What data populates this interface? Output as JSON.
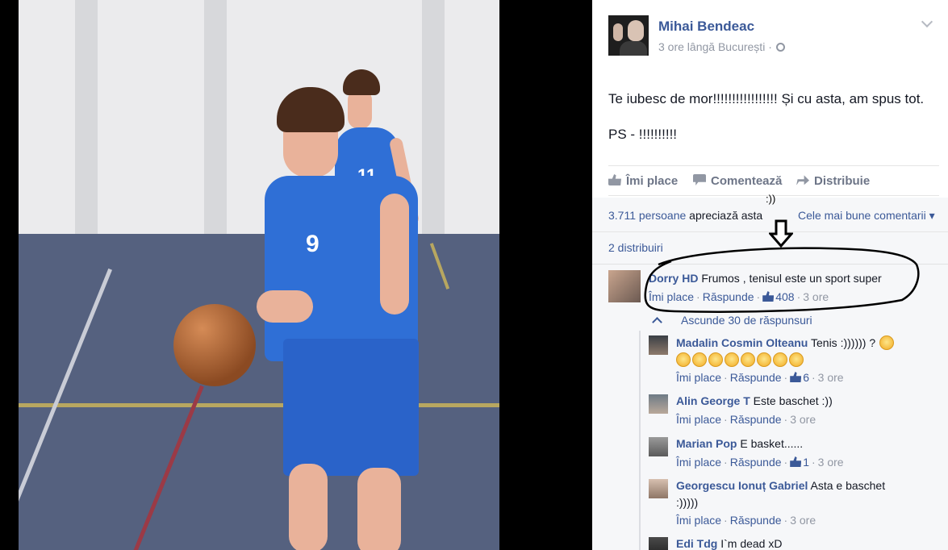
{
  "post": {
    "author": "Mihai Bendeac",
    "meta": "3 ore lângă București ·",
    "text": "Te iubesc de mor!!!!!!!!!!!!!!!!! Și cu asta, am spus tot.",
    "ps": "PS - !!!!!!!!!!"
  },
  "actions": {
    "like": "Îmi place",
    "comment": "Comentează",
    "share": "Distribuie"
  },
  "annotation": {
    "smile": ":))"
  },
  "stats": {
    "likes_number": "3.711 persoane",
    "likes_rest": " apreciază asta",
    "sort": "Cele mai bune comentarii",
    "shares": "2 distribuiri"
  },
  "top_comment": {
    "name": "Dorry HD",
    "text": " Frumos , tenisul este un sport super",
    "like": "Îmi place",
    "reply": "Răspunde",
    "likes": "408",
    "time": "3 ore"
  },
  "collapse": "Ascunde 30 de răspunsuri",
  "replies": [
    {
      "name": "Madalin Cosmin Olteanu",
      "text": " Tenis :)))))) ?",
      "like": "Îmi place",
      "reply": "Răspunde",
      "likes": "6",
      "time": "3 ore"
    },
    {
      "name": "Alin George T",
      "text": " Este baschet :))",
      "like": "Îmi place",
      "reply": "Răspunde",
      "time": "3 ore"
    },
    {
      "name": "Marian Pop",
      "text": " E basket......",
      "like": "Îmi place",
      "reply": "Răspunde",
      "likes": "1",
      "time": "3 ore"
    },
    {
      "name": "Georgescu Ionuț Gabriel",
      "text": " Asta e baschet",
      "text2": ":)))))",
      "like": "Îmi place",
      "reply": "Răspunde",
      "time": "3 ore"
    },
    {
      "name": "Edi Tdg",
      "text": " I`m dead xD"
    }
  ],
  "photo_jersey": {
    "front_number": "9",
    "back_number": "11"
  },
  "colors": {
    "link": "#3b5998",
    "muted": "#9197a3",
    "jersey": "#2f6fd6"
  }
}
